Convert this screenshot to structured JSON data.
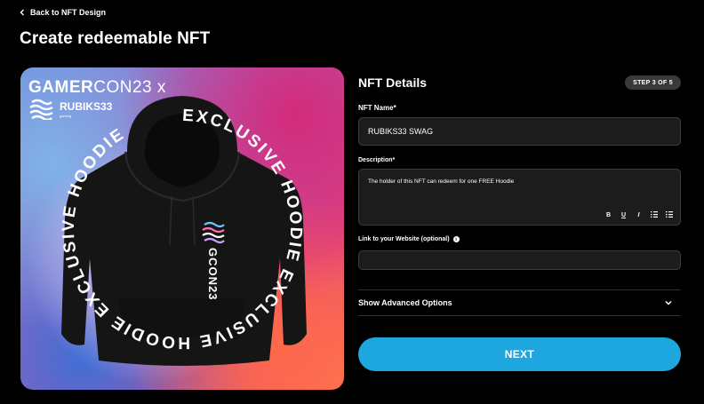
{
  "nav": {
    "back_label": "Back to NFT Design"
  },
  "page": {
    "title": "Create redeemable NFT"
  },
  "artwork": {
    "brand_strong": "GAMER",
    "brand_light": "CON23 x",
    "logo_name": "RUBIKS33",
    "logo_sub": "gaming",
    "ring_text": "EXCLUSIVE HOODIE EXCLUSIVE HOODIE EXCLUSIVE HOODIE",
    "sleeve_text": "GCON23"
  },
  "form": {
    "section_title": "NFT Details",
    "step_badge": "STEP 3 OF 5",
    "name_label": "NFT Name*",
    "name_value": "RUBIKS33 SWAG",
    "description_label": "Description*",
    "description_value": "The holder of this NFT can redeem for one FREE Hoodie",
    "toolbar": {
      "bold": "B",
      "underline": "U",
      "italic": "I",
      "ordered": "ol",
      "bullets": "ul"
    },
    "website_label": "Link to your Website (optional)",
    "website_value": "",
    "advanced_label": "Show Advanced Options",
    "next_label": "NEXT"
  },
  "colors": {
    "accent": "#1ea6df",
    "step_bg": "#3a3a3a",
    "field_bg": "#1c1c1c"
  }
}
